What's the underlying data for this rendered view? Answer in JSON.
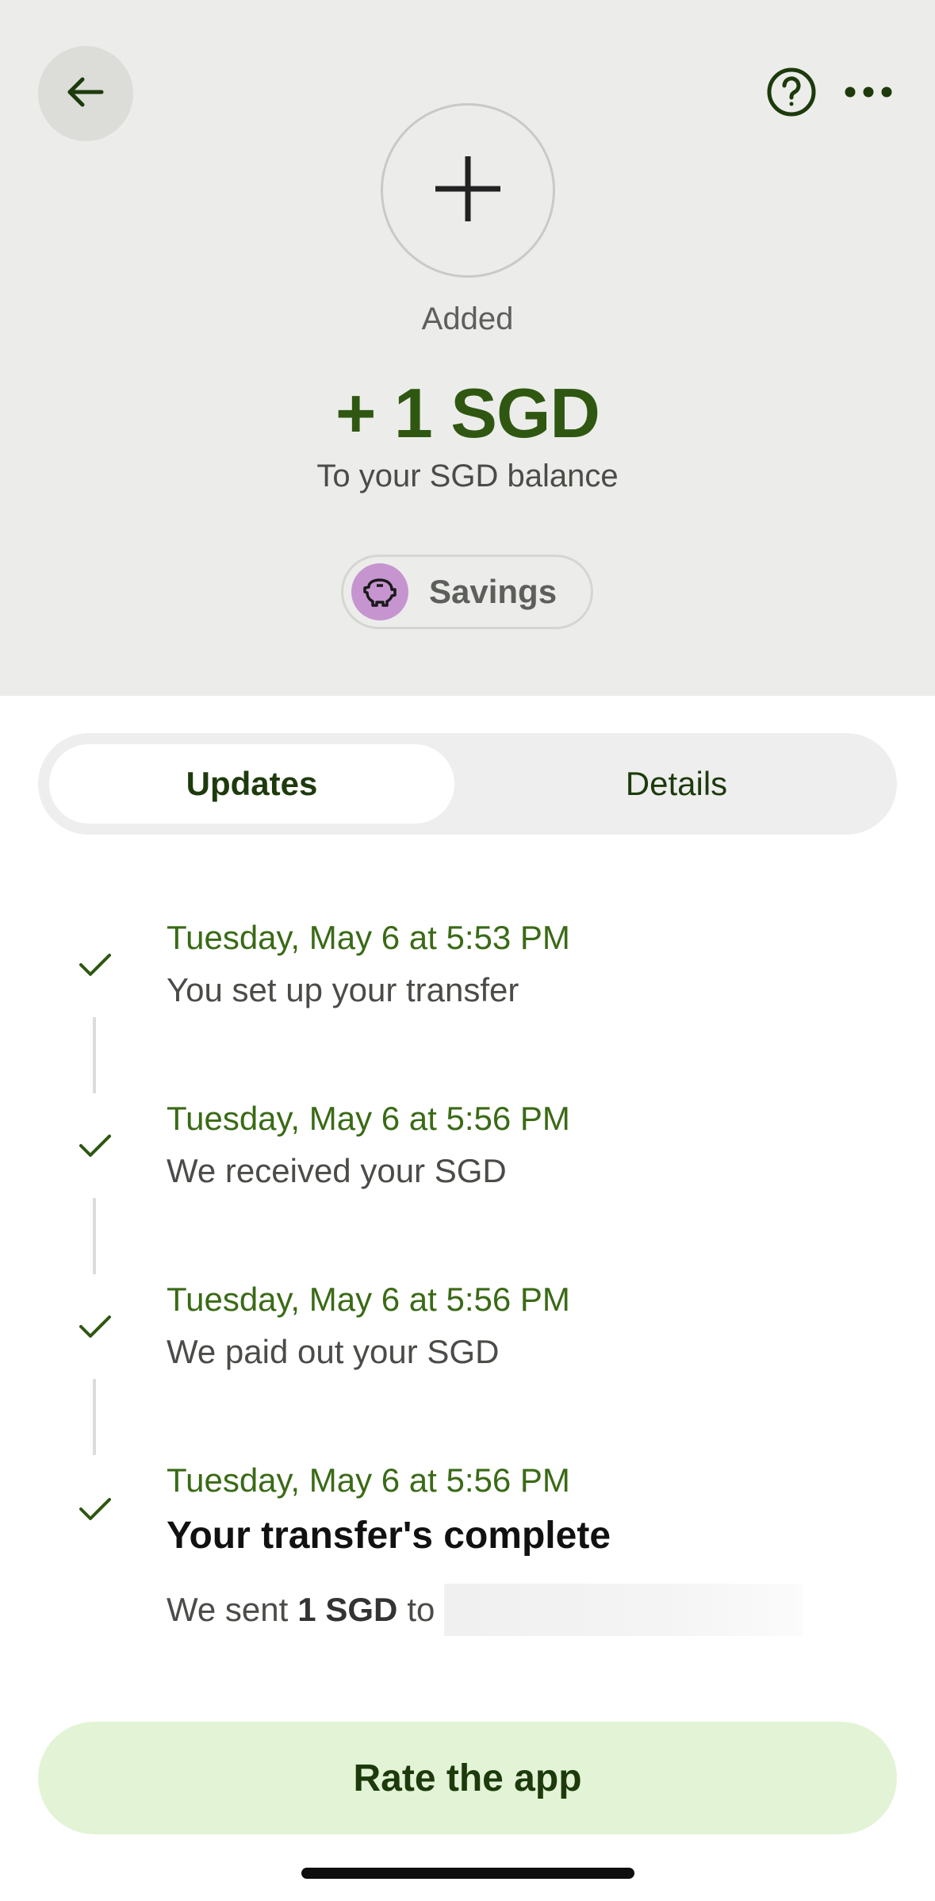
{
  "header": {
    "back_icon": "arrow-left-icon",
    "help_icon": "question-circle-icon",
    "more_icon": "more-horizontal-icon",
    "type_icon": "plus-icon",
    "status": "Added",
    "amount": "+ 1 SGD",
    "destination": "To your SGD balance",
    "chip": {
      "icon": "piggy-bank-icon",
      "label": "Savings",
      "icon_color": "#c695d0"
    }
  },
  "tabs": [
    {
      "label": "Updates",
      "active": true
    },
    {
      "label": "Details",
      "active": false
    }
  ],
  "timeline": [
    {
      "date": "Tuesday, May 6 at 5:53 PM",
      "text": "You set up your transfer"
    },
    {
      "date": "Tuesday, May 6 at 5:56 PM",
      "text": "We received your SGD"
    },
    {
      "date": "Tuesday, May 6 at 5:56 PM",
      "text": "We paid out your SGD"
    },
    {
      "date": "Tuesday, May 6 at 5:56 PM",
      "title": "Your transfer's complete",
      "sent_prefix": "We sent",
      "sent_amount": "1 SGD",
      "sent_to": "to"
    }
  ],
  "rate_button": "Rate the app",
  "colors": {
    "accent_green": "#2f5711",
    "date_green": "#3a6a16",
    "button_bg": "#e2f4d5",
    "header_bg": "#ecedea"
  }
}
